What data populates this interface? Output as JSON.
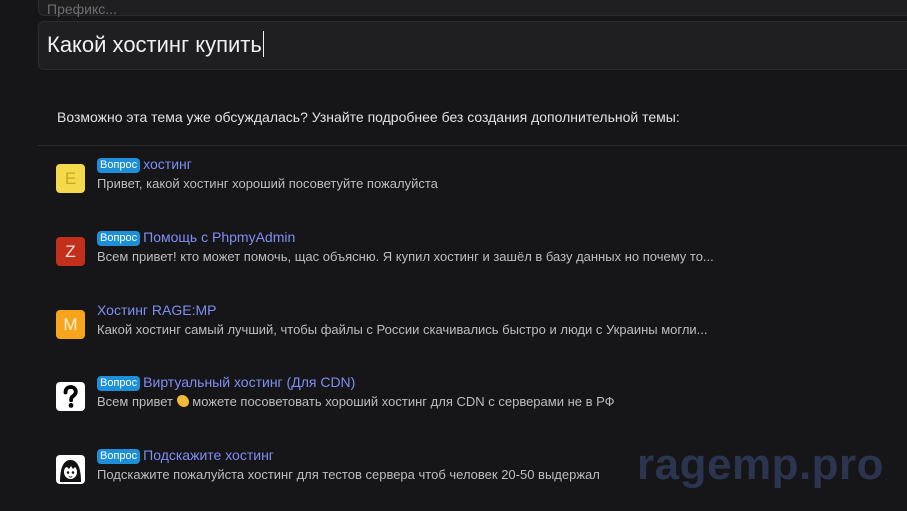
{
  "form": {
    "prefix_placeholder": "Префикс...",
    "title_value": "Какой хостинг купить"
  },
  "similar": {
    "heading": "Возможно эта тема уже обсуждалась? Узнайте подробнее без создания дополнительной темы:",
    "threads": [
      {
        "avatar_letter": "E",
        "avatar_color": "#f3d94b",
        "badge": "Вопрос",
        "title": "хостинг",
        "snippet": "Привет, какой хостинг хороший посоветуйте пожалуйста"
      },
      {
        "avatar_letter": "Z",
        "avatar_color": "#c2301c",
        "badge": "Вопрос",
        "title": "Помощь с PhpmyAdmin",
        "snippet": "Всем привет! кто может помочь, щас объясню. Я купил хостинг и зашёл в базу данных но почему то..."
      },
      {
        "avatar_letter": "M",
        "avatar_color": "#f6a51c",
        "title": "Хостинг RAGE:MP",
        "snippet": "Какой хостинг самый лучший, чтобы файлы с России скачивались быстро и люди с Украины могли..."
      },
      {
        "avatar_icon": "question-mark-icon",
        "badge": "Вопрос",
        "title": "Виртуальный хостинг (Для CDN)",
        "snippet_before": "Всем привет",
        "snippet_emoji": "waving-hand-icon",
        "snippet_after": "можете посоветовать хороший хостинг для CDN с серверами не в РФ"
      },
      {
        "avatar_icon": "anime-girl-avatar",
        "badge": "Вопрос",
        "title": "Подскажите хостинг",
        "snippet": "Подскажите пожалуйста хостинг для тестов сервера чтоб человек 20-50 выдержал"
      }
    ]
  },
  "watermark": "ragemp.pro",
  "colors": {
    "background": "#161618",
    "link": "#7f8ef2",
    "badge": "#1c8fd8"
  }
}
